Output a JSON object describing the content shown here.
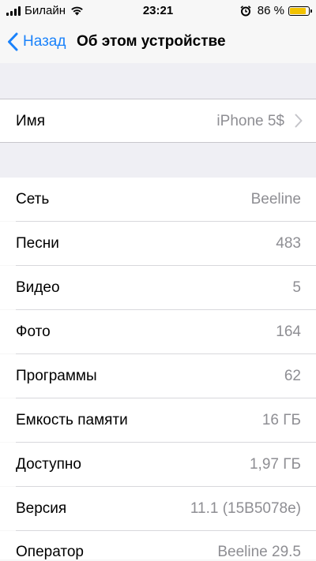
{
  "status_bar": {
    "carrier": "Билайн",
    "time": "23:21",
    "battery_percent": "86 %",
    "battery_level": 0.86,
    "icons": [
      "signal-icon",
      "wifi-icon",
      "alarm-icon",
      "battery-icon"
    ]
  },
  "nav": {
    "back_label": "Назад",
    "title": "Об этом устройстве"
  },
  "name_row": {
    "label": "Имя",
    "value": "iPhone 5$"
  },
  "info_rows": [
    {
      "label": "Сеть",
      "value": "Beeline"
    },
    {
      "label": "Песни",
      "value": "483"
    },
    {
      "label": "Видео",
      "value": "5"
    },
    {
      "label": "Фото",
      "value": "164"
    },
    {
      "label": "Программы",
      "value": "62"
    },
    {
      "label": "Емкость памяти",
      "value": "16 ГБ"
    },
    {
      "label": "Доступно",
      "value": "1,97 ГБ"
    },
    {
      "label": "Версия",
      "value": "11.1 (15B5078e)"
    },
    {
      "label": "Оператор",
      "value": "Beeline 29.5"
    }
  ],
  "colors": {
    "accent": "#1a82fb",
    "value_gray": "#8e8e93",
    "group_background": "#efeff4",
    "battery": "#f2c200"
  }
}
